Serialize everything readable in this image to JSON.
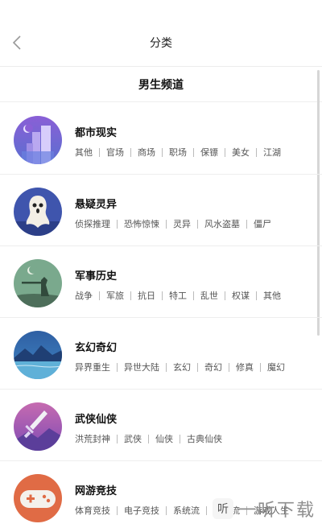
{
  "header": {
    "title": "分类"
  },
  "section": {
    "title": "男生频道"
  },
  "categories": [
    {
      "name": "都市现实",
      "tags": [
        "其他",
        "官场",
        "商场",
        "职场",
        "保镖",
        "美女",
        "江湖"
      ]
    },
    {
      "name": "悬疑灵异",
      "tags": [
        "侦探推理",
        "恐怖惊悚",
        "灵异",
        "风水盗墓",
        "僵尸"
      ]
    },
    {
      "name": "军事历史",
      "tags": [
        "战争",
        "军旅",
        "抗日",
        "特工",
        "乱世",
        "权谋",
        "其他"
      ]
    },
    {
      "name": "玄幻奇幻",
      "tags": [
        "异界重生",
        "异世大陆",
        "玄幻",
        "奇幻",
        "修真",
        "魔幻"
      ]
    },
    {
      "name": "武侠仙侠",
      "tags": [
        "洪荒封神",
        "武侠",
        "仙侠",
        "古典仙侠"
      ]
    },
    {
      "name": "网游竞技",
      "tags": [
        "体育竞技",
        "电子竞技",
        "系统流",
        "技术流",
        "游戏人生"
      ]
    }
  ],
  "watermark": {
    "text": "一听下载",
    "logo": "听"
  },
  "icons": {
    "back": "chevron-left-icon",
    "avatars": [
      "city-icon",
      "ghost-icon",
      "soldier-icon",
      "landscape-icon",
      "sword-icon",
      "gamepad-icon"
    ]
  },
  "colors": {
    "avatar_backgrounds": [
      "#6f55c8",
      "#3d5bb0",
      "#7aa98d",
      "#2f5fa3",
      "#b25bb0",
      "#e06b45"
    ]
  }
}
